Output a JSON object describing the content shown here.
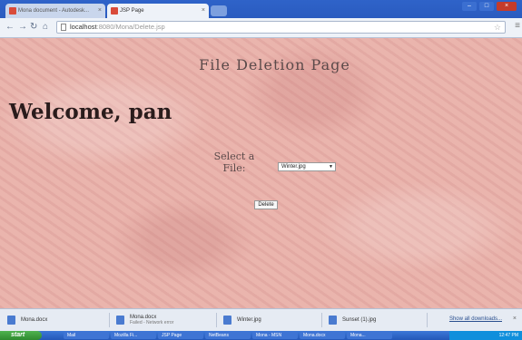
{
  "browser": {
    "tabs": [
      {
        "label": "Mona document - Autodesk..."
      },
      {
        "label": "JSP Page"
      }
    ],
    "address": {
      "host": "localhost",
      "path": ":8080/Mona/Delete.jsp"
    },
    "icons": {
      "back": "back-arrow-icon",
      "forward": "forward-arrow-icon",
      "reload": "reload-icon",
      "home": "home-icon",
      "star": "star-icon",
      "wrench": "wrench-icon"
    }
  },
  "page": {
    "title": "File Deletion Page",
    "welcome": "Welcome, pan",
    "select_label": "Select a File:",
    "selected_file": "Winter.jpg",
    "delete_label": "Delete"
  },
  "downloads": {
    "items": [
      {
        "name": "Mona.docx",
        "status": ""
      },
      {
        "name": "Mona.docx",
        "status": "Failed - Network error"
      },
      {
        "name": "Winter.jpg",
        "status": ""
      },
      {
        "name": "Sunset (1).jpg",
        "status": ""
      }
    ],
    "show_all": "Show all downloads...",
    "close": "×"
  },
  "taskbar": {
    "start": "start",
    "tasks": [
      "Mail",
      "Mozilla Fi...",
      "JSP Page",
      "NetBeans",
      "Mona - MSN",
      "Mona.docx",
      "Mona..."
    ],
    "clock": "12:47 PM"
  },
  "colors": {
    "page_bg": "#e9b3ab",
    "titlebar": "#2f63c9"
  }
}
